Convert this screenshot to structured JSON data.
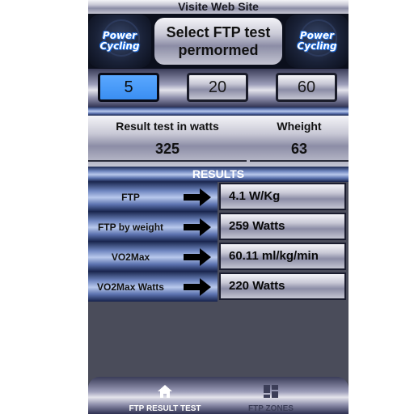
{
  "top_link": "Visite Web Site",
  "header": {
    "logo_text": "Power Cycling",
    "title": "Select FTP test permormed"
  },
  "test_buttons": [
    {
      "label": "5",
      "active": true
    },
    {
      "label": "20",
      "active": false
    },
    {
      "label": "60",
      "active": false
    }
  ],
  "inputs": {
    "result_label": "Result test in watts",
    "result_value": "325",
    "weight_label": "Wheight",
    "weight_value": "63"
  },
  "results_header": "RESULTS",
  "results": [
    {
      "label": "FTP",
      "value": "4.1 W/Kg"
    },
    {
      "label": "FTP by weight",
      "value": "259 Watts"
    },
    {
      "label": "VO2Max",
      "value": "60.11 ml/kg/min"
    },
    {
      "label": "VO2Max Watts",
      "value": "220 Watts"
    }
  ],
  "bottom_nav": {
    "items": [
      {
        "label": "FTP RESULT TEST",
        "icon": "home-icon",
        "active": true
      },
      {
        "label": "FTP ZONES",
        "icon": "grid-icon",
        "active": false
      }
    ]
  },
  "colors": {
    "active_button": "#4a9bff",
    "panel_blue": "#1d2a52",
    "background": "#4a4c5a"
  }
}
